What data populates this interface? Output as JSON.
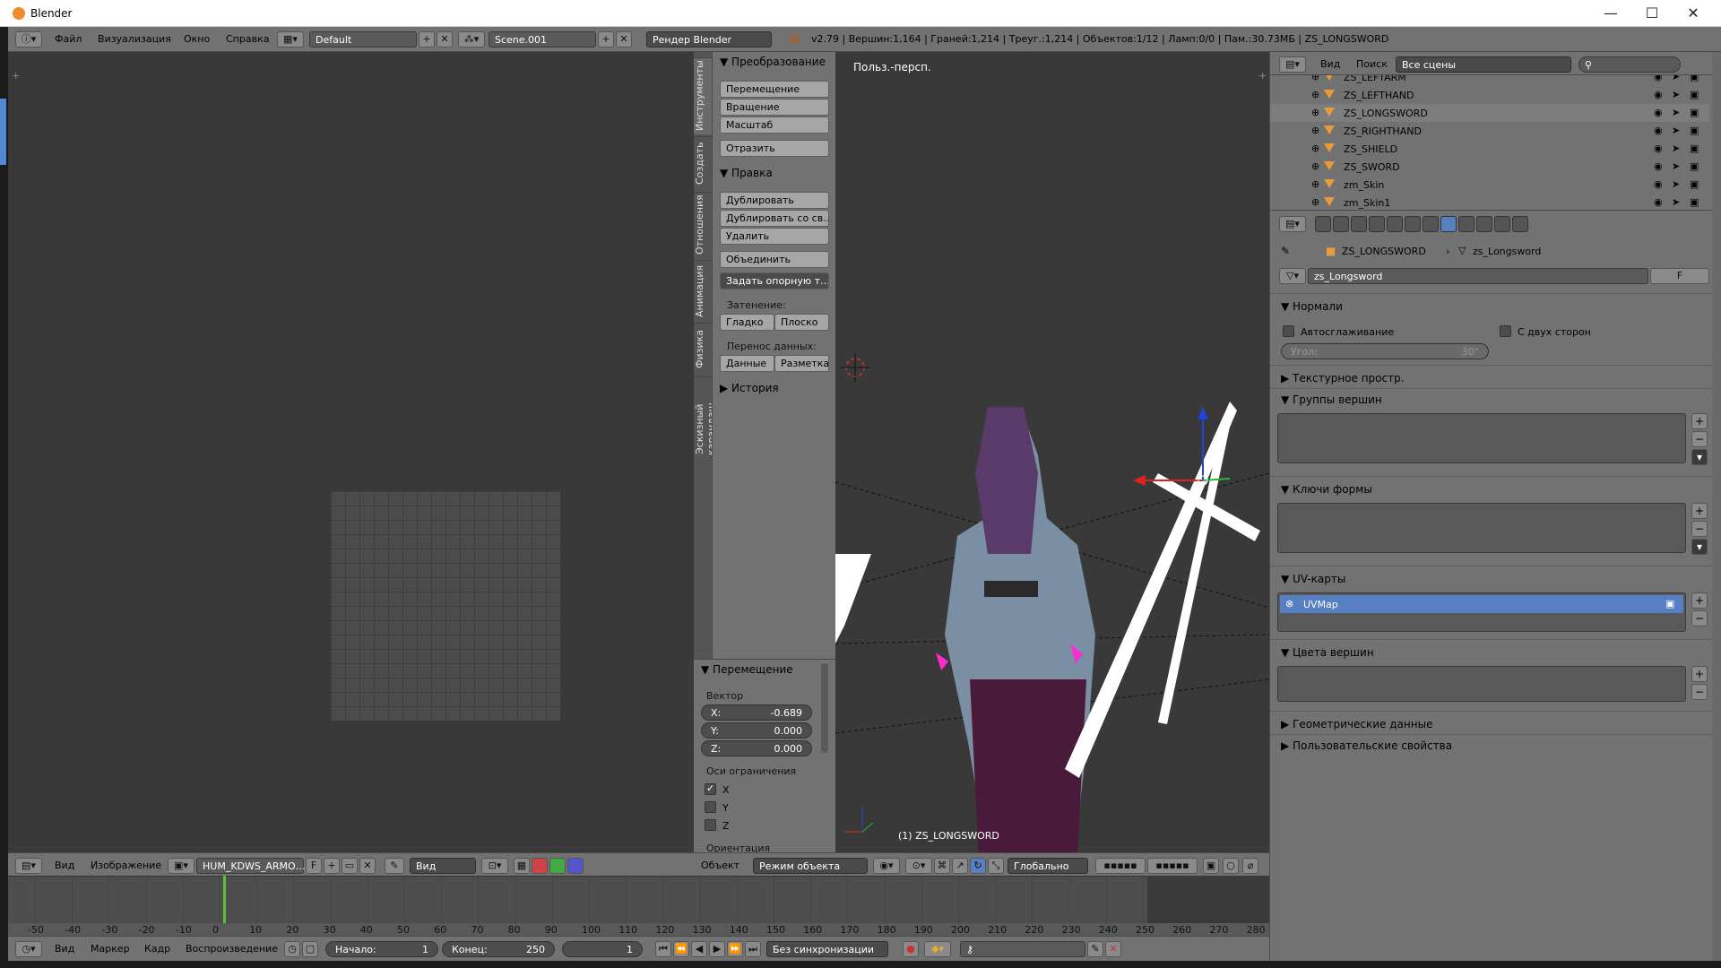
{
  "window": {
    "title": "Blender",
    "min": "—",
    "max": "☐",
    "close": "✕"
  },
  "infobar": {
    "menus": [
      "Файл",
      "Визуализация",
      "Окно",
      "Справка"
    ],
    "screen_layout": "Default",
    "scene": "Scene.001",
    "render_engine": "Рендер Blender",
    "stats": "v2.79 | Вершин:1,164 | Граней:1,214 | Треуг.:1,214 | Объектов:1/12 | Ламп:0/0 | Пам.:30.73МБ | ZS_LONGSWORD"
  },
  "tool_tabs": [
    "Инструменты",
    "Создать",
    "Отношения",
    "Анимация",
    "Физика",
    "Эскизный карандаш"
  ],
  "toolshelf": {
    "transform_header": "▼ Преобразование",
    "translate": "Перемещение",
    "rotate": "Вращение",
    "scale": "Масштаб",
    "mirror": "Отразить",
    "edit_header": "▼ Правка",
    "duplicate": "Дублировать",
    "duplicate_linked": "Дублировать со св…",
    "delete": "Удалить",
    "join": "Объединить",
    "set_origin": "Задать опорную т…",
    "shading_label": "Затенение:",
    "smooth": "Гладко",
    "flat": "Плоско",
    "data_transfer_label": "Перенос данных:",
    "data": "Данные",
    "layout": "Разметка",
    "history_header": "▶ История"
  },
  "operator_panel": {
    "header": "▼ Перемещение",
    "vector_label": "Вектор",
    "x_label": "X:",
    "x_value": "-0.689",
    "y_label": "Y:",
    "y_value": "0.000",
    "z_label": "Z:",
    "z_value": "0.000",
    "constraint_label": "Оси ограничения",
    "cx": "X",
    "cy": "Y",
    "cz": "Z",
    "cx_on": true,
    "orientation_label": "Ориентация"
  },
  "viewport": {
    "view_label": "Польз.-персп.",
    "object_label": "(1) ZS_LONGSWORD",
    "header": {
      "object_menu": "Объект",
      "mode": "Режим объекта",
      "orientation": "Глобально"
    }
  },
  "image_editor": {
    "header": {
      "view": "Вид",
      "image": "Изображение",
      "image_name": "HUM_KDWS_ARMO…",
      "fake_user": "F",
      "view_dd": "Вид"
    }
  },
  "outliner": {
    "view": "Вид",
    "search": "Поиск",
    "filter": "Все сцены",
    "rows": [
      {
        "name": "ZS_LEFTARM",
        "selected": false
      },
      {
        "name": "ZS_LEFTHAND",
        "selected": false
      },
      {
        "name": "ZS_LONGSWORD",
        "selected": true
      },
      {
        "name": "ZS_RIGHTHAND",
        "selected": false
      },
      {
        "name": "ZS_SHIELD",
        "selected": false
      },
      {
        "name": "ZS_SWORD",
        "selected": false
      },
      {
        "name": "zm_Skin",
        "selected": false
      },
      {
        "name": "zm_Skin1",
        "selected": false
      }
    ]
  },
  "properties": {
    "breadcrumb_object": "ZS_LONGSWORD",
    "breadcrumb_mesh": "zs_Longsword",
    "mesh_name": "zs_Longsword",
    "fake_user": "F",
    "normals_header": "Нормали",
    "autosmooth": "Автосглаживание",
    "double_sided": "С двух сторон",
    "angle_label": "Угол:",
    "angle_value": "30°",
    "texture_space": "Текстурное простр.",
    "vertex_groups": "Группы вершин",
    "shape_keys": "Ключи формы",
    "uv_maps": "UV-карты",
    "uvmap_name": "UVMap",
    "vertex_colors": "Цвета вершин",
    "geometry_data": "Геометрические данные",
    "custom_props": "Пользовательские свойства",
    "plus": "+",
    "minus": "−"
  },
  "timeline": {
    "ticks": [
      "-50",
      "-40",
      "-30",
      "-20",
      "-10",
      "0",
      "10",
      "20",
      "30",
      "40",
      "50",
      "60",
      "70",
      "80",
      "90",
      "100",
      "110",
      "120",
      "130",
      "140",
      "150",
      "160",
      "170",
      "180",
      "190",
      "200",
      "210",
      "220",
      "230",
      "240",
      "250",
      "260",
      "270",
      "280"
    ],
    "current_frame": 1,
    "menus": [
      "Вид",
      "Маркер",
      "Кадр",
      "Воспроизведение"
    ],
    "start_label": "Начало:",
    "start_value": "1",
    "end_label": "Конец:",
    "end_value": "250",
    "frame_value": "1",
    "sync": "Без синхронизации"
  }
}
